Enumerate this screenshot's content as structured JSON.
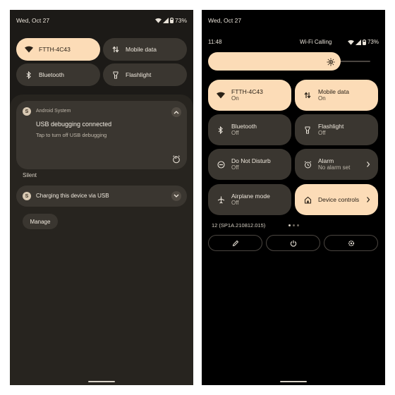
{
  "left": {
    "status": {
      "date": "Wed, Oct 27",
      "battery": "73%"
    },
    "tiles": [
      {
        "label": "FTTH-4C43",
        "icon": "wifi-icon",
        "active": true
      },
      {
        "label": "Mobile data",
        "icon": "mobile-data-icon",
        "active": false
      },
      {
        "label": "Bluetooth",
        "icon": "bluetooth-icon",
        "active": false
      },
      {
        "label": "Flashlight",
        "icon": "flashlight-icon",
        "active": false
      }
    ],
    "notification": {
      "app_badge": "S",
      "app_name": "Android System",
      "title": "USB debugging connected",
      "body": "Tap to turn off USB debugging",
      "snooze_badge": "z"
    },
    "silent_label": "Silent",
    "silent_notification": {
      "app_badge": "S",
      "text": "Charging this device via USB"
    },
    "manage_label": "Manage"
  },
  "right": {
    "status": {
      "date": "Wed, Oct 27",
      "time": "11:48",
      "wifi_calling": "Wi-Fi Calling",
      "battery": "73%"
    },
    "brightness_fraction": 0.8,
    "tiles": [
      {
        "title": "FTTH-4C43",
        "subtitle": "On",
        "icon": "wifi-icon",
        "active": true
      },
      {
        "title": "Mobile data",
        "subtitle": "On",
        "icon": "mobile-data-icon",
        "active": true
      },
      {
        "title": "Bluetooth",
        "subtitle": "Off",
        "icon": "bluetooth-icon",
        "active": false
      },
      {
        "title": "Flashlight",
        "subtitle": "Off",
        "icon": "flashlight-icon",
        "active": false
      },
      {
        "title": "Do Not Disturb",
        "subtitle": "Off",
        "icon": "do-not-disturb-icon",
        "active": false
      },
      {
        "title": "Alarm",
        "subtitle": "No alarm set",
        "icon": "alarm-icon",
        "active": false
      },
      {
        "title": "Airplane mode",
        "subtitle": "Off",
        "icon": "airplane-icon",
        "active": false
      },
      {
        "title": "Device controls",
        "subtitle": "",
        "icon": "home-icon",
        "active": true
      }
    ],
    "build": "12 (SP1A.210812.015)",
    "page_indicator": {
      "current": 1,
      "total": 3
    },
    "actions": [
      {
        "icon": "edit-icon"
      },
      {
        "icon": "power-icon"
      },
      {
        "icon": "settings-icon"
      }
    ]
  },
  "colors": {
    "accent": "#fcdcb7",
    "tile_inactive": "#3a3630",
    "left_background": "#1c1a17",
    "right_background": "#000000"
  }
}
